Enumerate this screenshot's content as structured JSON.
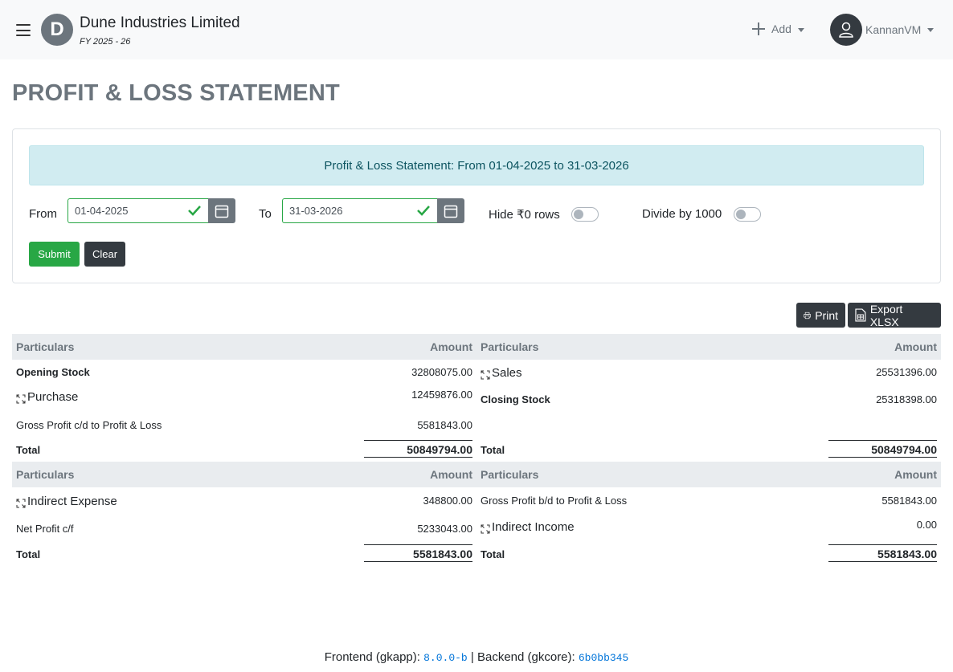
{
  "navbar": {
    "logo_letter": "D",
    "org_name": "Dune Industries Limited",
    "fy_label": "FY 2025 - 26",
    "add_label": "Add",
    "user_name": "KannanVM"
  },
  "page_title": "PROFIT & LOSS STATEMENT",
  "filters": {
    "banner": "Profit & Loss Statement: From 01-04-2025 to 31-03-2026",
    "from_label": "From",
    "from_value": "01-04-2025",
    "to_label": "To",
    "to_value": "31-03-2026",
    "hide_zero_label": "Hide ₹0 rows",
    "hide_zero_on": false,
    "divide_label": "Divide by 1000",
    "divide_on": false,
    "submit_label": "Submit",
    "clear_label": "Clear"
  },
  "actions": {
    "print_label": "Print",
    "export_label": "Export XLSX"
  },
  "trading": {
    "headers": [
      "Particulars",
      "Amount",
      "Particulars",
      "Amount"
    ],
    "left": [
      {
        "name": "Opening Stock",
        "amount": "32808075.00"
      },
      {
        "name": "Purchase",
        "amount": "12459876.00"
      },
      {
        "name": "Gross Profit c/d to Profit & Loss",
        "amount": "5581843.00"
      }
    ],
    "right": [
      {
        "name": "Sales",
        "amount": "25531396.00"
      },
      {
        "name": "Closing Stock",
        "amount": "25318398.00"
      }
    ],
    "total_label": "Total",
    "left_total": "50849794.00",
    "right_total": "50849794.00"
  },
  "pl": {
    "headers": [
      "Particulars",
      "Amount",
      "Particulars",
      "Amount"
    ],
    "left": [
      {
        "name": "Indirect Expense",
        "amount": "348800.00"
      },
      {
        "name": "Net Profit c/f",
        "amount": "5233043.00"
      }
    ],
    "right": [
      {
        "name": "Gross Profit b/d to Profit & Loss",
        "amount": "5581843.00"
      },
      {
        "name": "Indirect Income",
        "amount": "0.00"
      }
    ],
    "total_label": "Total",
    "left_total": "5581843.00",
    "right_total": "5581843.00"
  },
  "footer": {
    "frontend_label": "Frontend (gkapp):",
    "frontend_version": "8.0.0-b",
    "separator": "|",
    "backend_label": "Backend (gkcore):",
    "backend_version": "6b0bb345"
  },
  "icons": {
    "menu": "hamburger-icon",
    "add": "plus-icon",
    "user": "user-icon",
    "calendar": "calendar-icon",
    "valid": "check-icon",
    "print": "printer-icon",
    "export": "spreadsheet-icon",
    "expand": "expand-icon"
  },
  "colors": {
    "success": "#28a745",
    "dark": "#343a40",
    "info_bg": "#d1ecf1",
    "info_text": "#0c5460",
    "muted": "#6c757d",
    "link": "#0074d9"
  }
}
